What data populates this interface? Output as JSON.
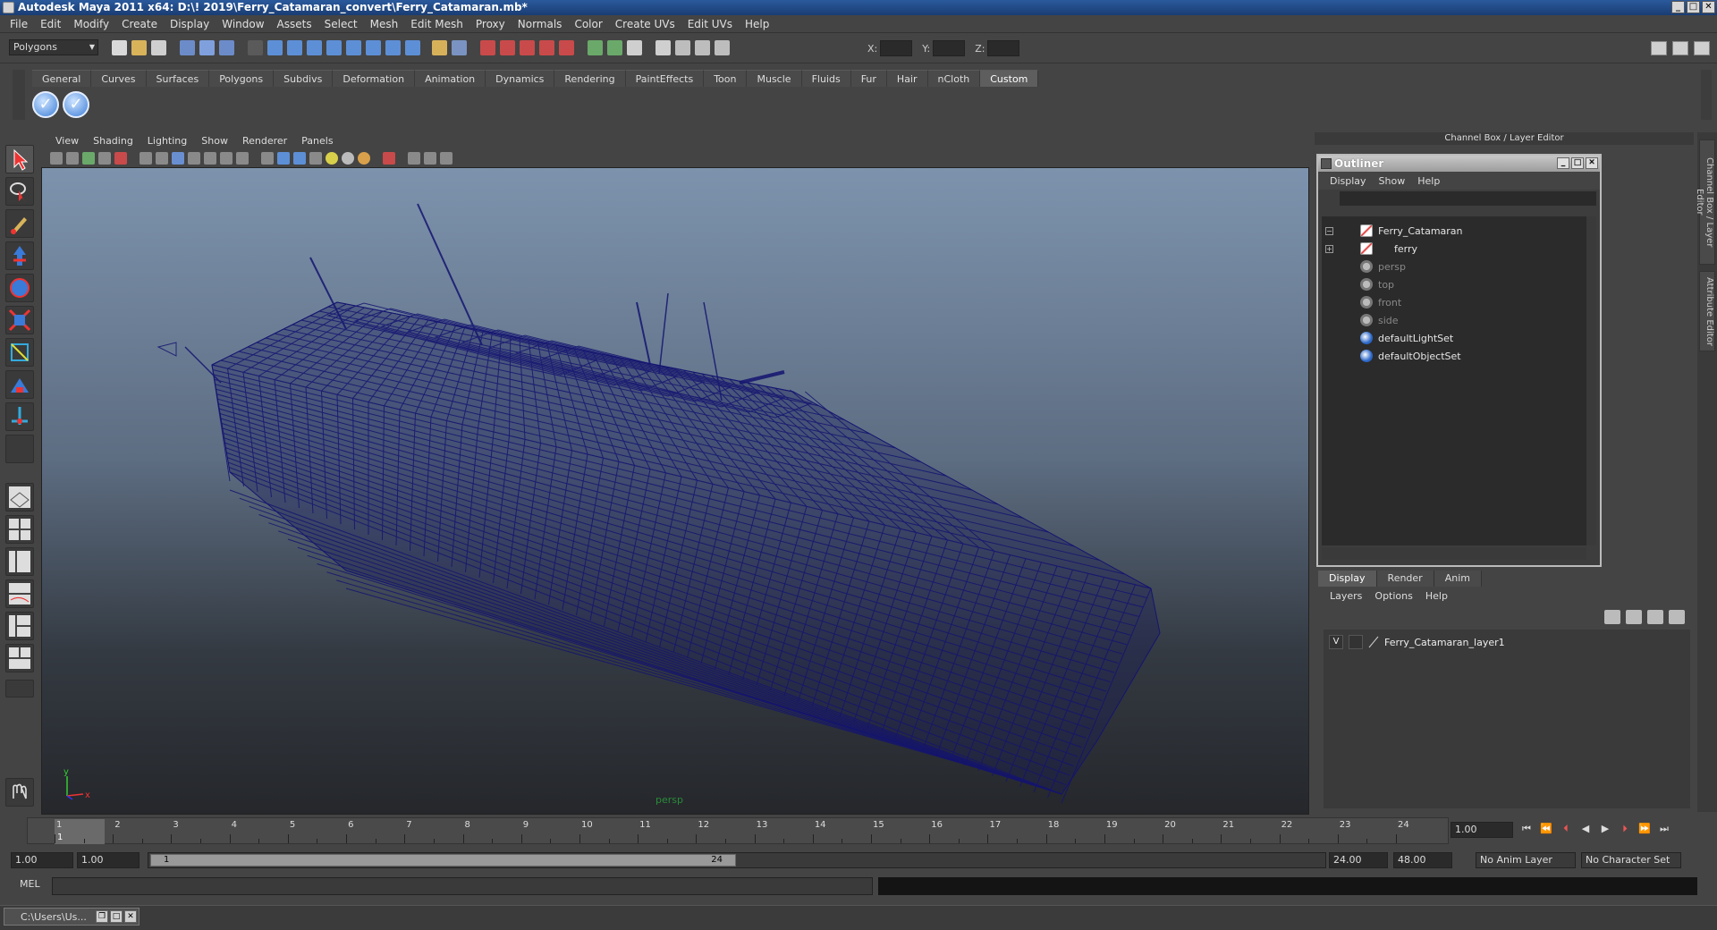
{
  "window": {
    "title": "Autodesk Maya 2011 x64: D:\\! 2019\\Ferry_Catamaran_convert\\Ferry_Catamaran.mb*"
  },
  "menubar": [
    "File",
    "Edit",
    "Modify",
    "Create",
    "Display",
    "Window",
    "Assets",
    "Select",
    "Mesh",
    "Edit Mesh",
    "Proxy",
    "Normals",
    "Color",
    "Create UVs",
    "Edit UVs",
    "Help"
  ],
  "statusline": {
    "mode": "Polygons",
    "x_label": "X:",
    "y_label": "Y:",
    "z_label": "Z:"
  },
  "shelf": {
    "tabs": [
      "General",
      "Curves",
      "Surfaces",
      "Polygons",
      "Subdivs",
      "Deformation",
      "Animation",
      "Dynamics",
      "Rendering",
      "PaintEffects",
      "Toon",
      "Muscle",
      "Fluids",
      "Fur",
      "Hair",
      "nCloth",
      "Custom"
    ],
    "active": "Custom"
  },
  "viewport": {
    "menu": [
      "View",
      "Shading",
      "Lighting",
      "Show",
      "Renderer",
      "Panels"
    ],
    "camera_label": "persp",
    "axis_y": "y",
    "axis_x": "x"
  },
  "channel_box": {
    "title": "Channel Box / Layer Editor",
    "side_tabs": [
      "Channel Box / Layer Editor",
      "Attribute Editor"
    ]
  },
  "outliner": {
    "title": "Outliner",
    "menu": [
      "Display",
      "Show",
      "Help"
    ],
    "items": [
      {
        "label": "Ferry_Catamaran",
        "icon": "transform-icon",
        "dim": false,
        "expander": "−"
      },
      {
        "label": "ferry",
        "icon": "transform-icon",
        "dim": false,
        "expander": "+"
      },
      {
        "label": "persp",
        "icon": "camera-icon",
        "dim": true
      },
      {
        "label": "top",
        "icon": "camera-icon",
        "dim": true
      },
      {
        "label": "front",
        "icon": "camera-icon",
        "dim": true
      },
      {
        "label": "side",
        "icon": "camera-icon",
        "dim": true
      },
      {
        "label": "defaultLightSet",
        "icon": "set-icon",
        "dim": false
      },
      {
        "label": "defaultObjectSet",
        "icon": "set-icon",
        "dim": false
      }
    ]
  },
  "layer_editor": {
    "tabs": [
      "Display",
      "Render",
      "Anim"
    ],
    "active": "Display",
    "menu": [
      "Layers",
      "Options",
      "Help"
    ],
    "layers": [
      {
        "visible": "V",
        "name": "Ferry_Catamaran_layer1"
      }
    ]
  },
  "timeslider": {
    "ticks": [
      "1",
      "2",
      "3",
      "4",
      "5",
      "6",
      "7",
      "8",
      "9",
      "10",
      "11",
      "12",
      "13",
      "14",
      "15",
      "16",
      "17",
      "18",
      "19",
      "20",
      "21",
      "22",
      "23",
      "24"
    ],
    "current_frame_marker": "1",
    "current_time": "1.00"
  },
  "range": {
    "start": "1.00",
    "playback_start": "1.00",
    "range_min": "1",
    "range_max": "24",
    "playback_end": "24.00",
    "end": "48.00",
    "anim_layer": "No Anim Layer",
    "character_set": "No Character Set"
  },
  "commandline": {
    "label": "MEL"
  },
  "taskbar": {
    "item": "C:\\Users\\Us..."
  }
}
